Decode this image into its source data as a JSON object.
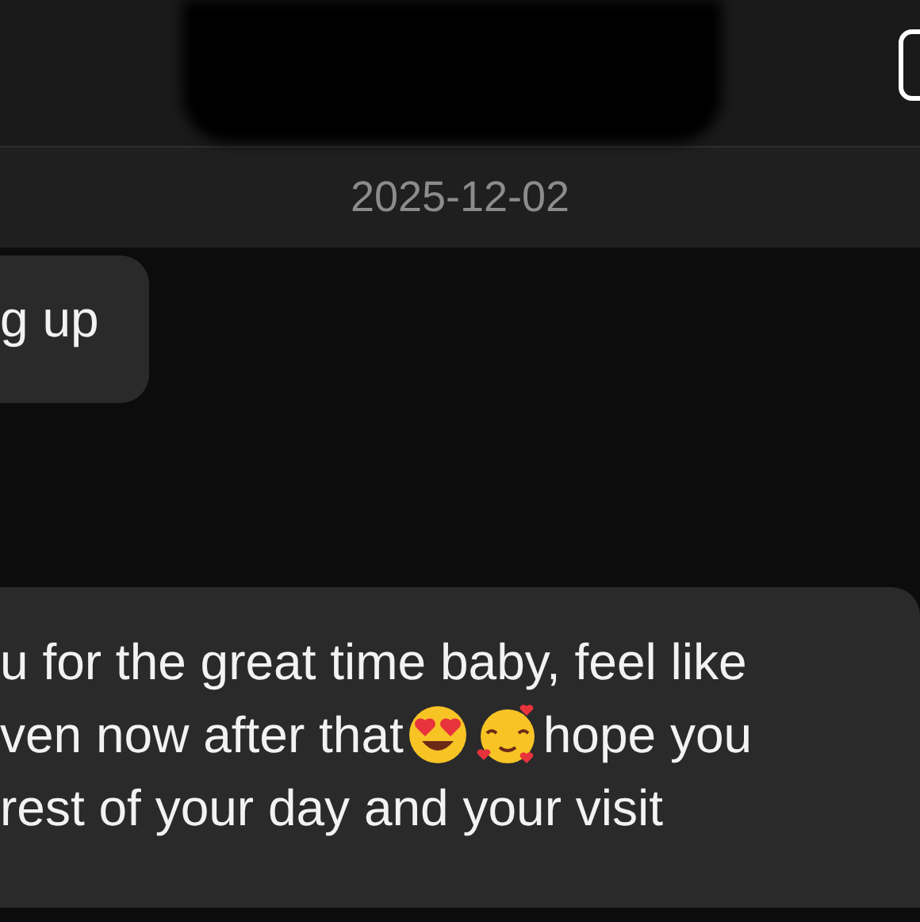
{
  "date_separator": "2025-12-02",
  "messages": [
    {
      "lines": [
        [
          {
            "kind": "text",
            "text": "g up"
          }
        ]
      ]
    },
    {
      "lines": [
        [
          {
            "kind": "text",
            "text": "u for the great time baby, feel like"
          }
        ],
        [
          {
            "kind": "text",
            "text": "ven now after that"
          },
          {
            "kind": "heart-eyes"
          },
          {
            "kind": "hearts"
          },
          {
            "kind": "text",
            "text": " hope you"
          }
        ],
        [
          {
            "kind": "text",
            "text": "rest of your day and your visit"
          }
        ]
      ]
    }
  ]
}
